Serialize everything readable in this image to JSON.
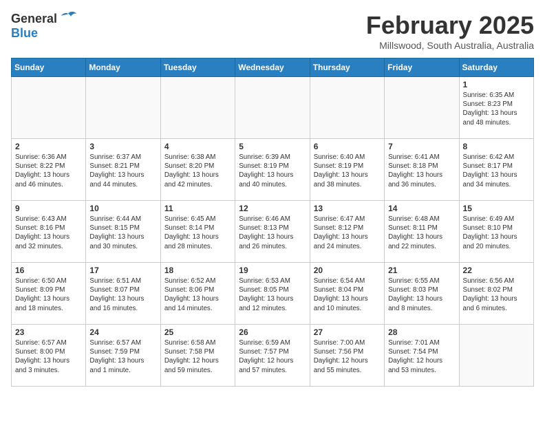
{
  "header": {
    "logo_general": "General",
    "logo_blue": "Blue",
    "month_title": "February 2025",
    "location": "Millswood, South Australia, Australia"
  },
  "weekdays": [
    "Sunday",
    "Monday",
    "Tuesday",
    "Wednesday",
    "Thursday",
    "Friday",
    "Saturday"
  ],
  "weeks": [
    [
      {
        "day": "",
        "info": ""
      },
      {
        "day": "",
        "info": ""
      },
      {
        "day": "",
        "info": ""
      },
      {
        "day": "",
        "info": ""
      },
      {
        "day": "",
        "info": ""
      },
      {
        "day": "",
        "info": ""
      },
      {
        "day": "1",
        "info": "Sunrise: 6:35 AM\nSunset: 8:23 PM\nDaylight: 13 hours\nand 48 minutes."
      }
    ],
    [
      {
        "day": "2",
        "info": "Sunrise: 6:36 AM\nSunset: 8:22 PM\nDaylight: 13 hours\nand 46 minutes."
      },
      {
        "day": "3",
        "info": "Sunrise: 6:37 AM\nSunset: 8:21 PM\nDaylight: 13 hours\nand 44 minutes."
      },
      {
        "day": "4",
        "info": "Sunrise: 6:38 AM\nSunset: 8:20 PM\nDaylight: 13 hours\nand 42 minutes."
      },
      {
        "day": "5",
        "info": "Sunrise: 6:39 AM\nSunset: 8:19 PM\nDaylight: 13 hours\nand 40 minutes."
      },
      {
        "day": "6",
        "info": "Sunrise: 6:40 AM\nSunset: 8:19 PM\nDaylight: 13 hours\nand 38 minutes."
      },
      {
        "day": "7",
        "info": "Sunrise: 6:41 AM\nSunset: 8:18 PM\nDaylight: 13 hours\nand 36 minutes."
      },
      {
        "day": "8",
        "info": "Sunrise: 6:42 AM\nSunset: 8:17 PM\nDaylight: 13 hours\nand 34 minutes."
      }
    ],
    [
      {
        "day": "9",
        "info": "Sunrise: 6:43 AM\nSunset: 8:16 PM\nDaylight: 13 hours\nand 32 minutes."
      },
      {
        "day": "10",
        "info": "Sunrise: 6:44 AM\nSunset: 8:15 PM\nDaylight: 13 hours\nand 30 minutes."
      },
      {
        "day": "11",
        "info": "Sunrise: 6:45 AM\nSunset: 8:14 PM\nDaylight: 13 hours\nand 28 minutes."
      },
      {
        "day": "12",
        "info": "Sunrise: 6:46 AM\nSunset: 8:13 PM\nDaylight: 13 hours\nand 26 minutes."
      },
      {
        "day": "13",
        "info": "Sunrise: 6:47 AM\nSunset: 8:12 PM\nDaylight: 13 hours\nand 24 minutes."
      },
      {
        "day": "14",
        "info": "Sunrise: 6:48 AM\nSunset: 8:11 PM\nDaylight: 13 hours\nand 22 minutes."
      },
      {
        "day": "15",
        "info": "Sunrise: 6:49 AM\nSunset: 8:10 PM\nDaylight: 13 hours\nand 20 minutes."
      }
    ],
    [
      {
        "day": "16",
        "info": "Sunrise: 6:50 AM\nSunset: 8:09 PM\nDaylight: 13 hours\nand 18 minutes."
      },
      {
        "day": "17",
        "info": "Sunrise: 6:51 AM\nSunset: 8:07 PM\nDaylight: 13 hours\nand 16 minutes."
      },
      {
        "day": "18",
        "info": "Sunrise: 6:52 AM\nSunset: 8:06 PM\nDaylight: 13 hours\nand 14 minutes."
      },
      {
        "day": "19",
        "info": "Sunrise: 6:53 AM\nSunset: 8:05 PM\nDaylight: 13 hours\nand 12 minutes."
      },
      {
        "day": "20",
        "info": "Sunrise: 6:54 AM\nSunset: 8:04 PM\nDaylight: 13 hours\nand 10 minutes."
      },
      {
        "day": "21",
        "info": "Sunrise: 6:55 AM\nSunset: 8:03 PM\nDaylight: 13 hours\nand 8 minutes."
      },
      {
        "day": "22",
        "info": "Sunrise: 6:56 AM\nSunset: 8:02 PM\nDaylight: 13 hours\nand 6 minutes."
      }
    ],
    [
      {
        "day": "23",
        "info": "Sunrise: 6:57 AM\nSunset: 8:00 PM\nDaylight: 13 hours\nand 3 minutes."
      },
      {
        "day": "24",
        "info": "Sunrise: 6:57 AM\nSunset: 7:59 PM\nDaylight: 13 hours\nand 1 minute."
      },
      {
        "day": "25",
        "info": "Sunrise: 6:58 AM\nSunset: 7:58 PM\nDaylight: 12 hours\nand 59 minutes."
      },
      {
        "day": "26",
        "info": "Sunrise: 6:59 AM\nSunset: 7:57 PM\nDaylight: 12 hours\nand 57 minutes."
      },
      {
        "day": "27",
        "info": "Sunrise: 7:00 AM\nSunset: 7:56 PM\nDaylight: 12 hours\nand 55 minutes."
      },
      {
        "day": "28",
        "info": "Sunrise: 7:01 AM\nSunset: 7:54 PM\nDaylight: 12 hours\nand 53 minutes."
      },
      {
        "day": "",
        "info": ""
      }
    ]
  ]
}
